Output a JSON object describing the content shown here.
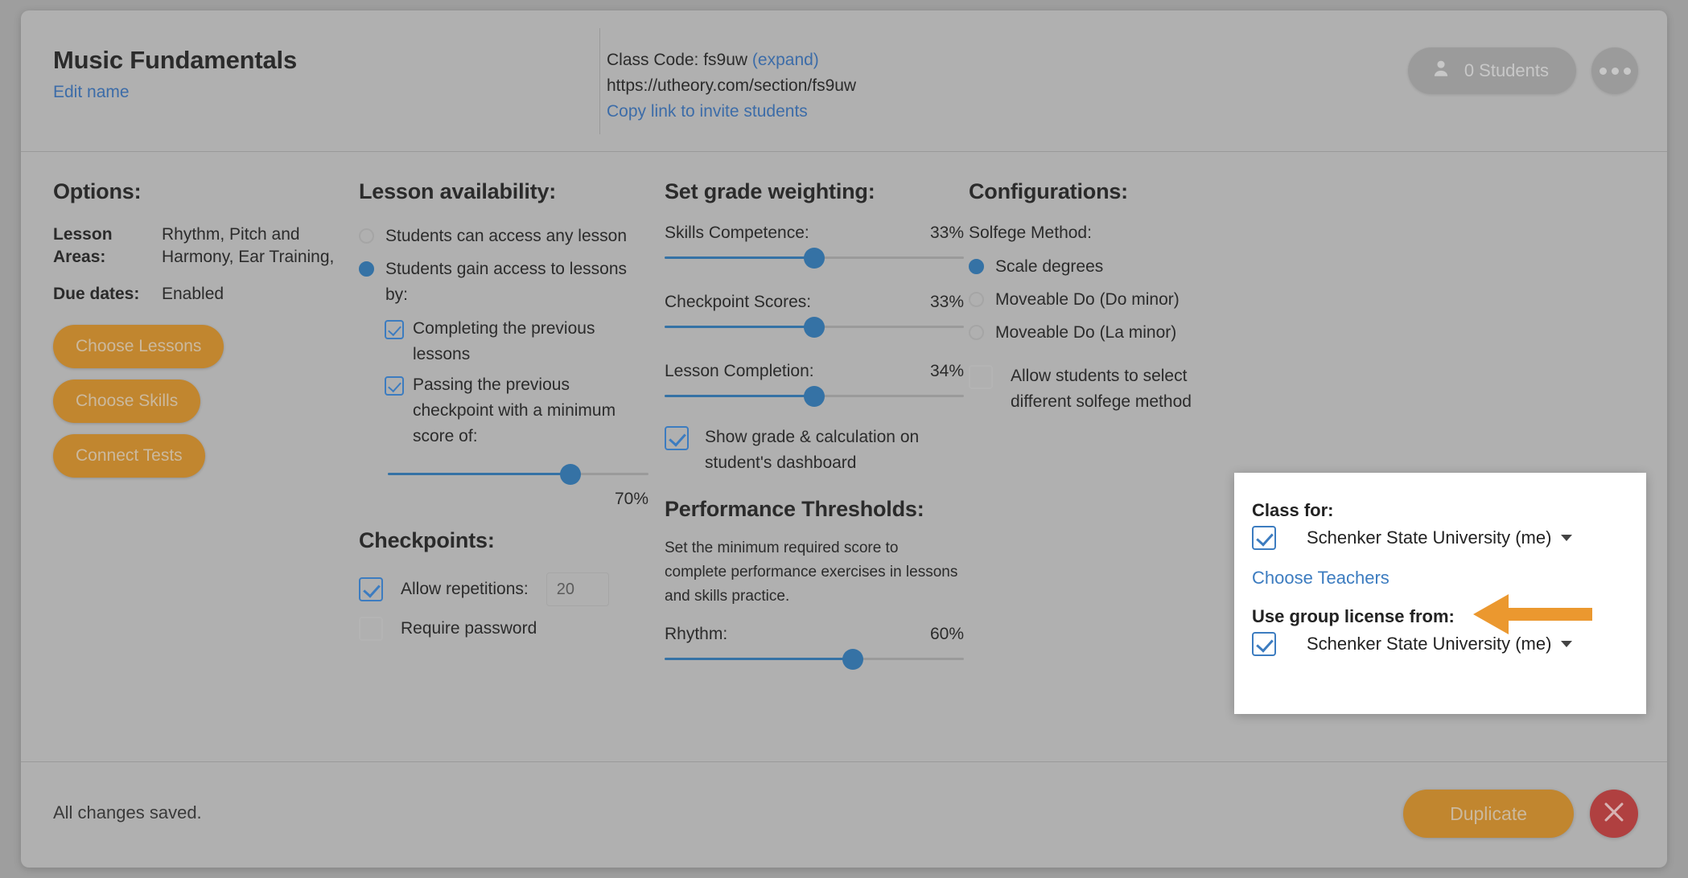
{
  "header": {
    "class_title": "Music Fundamentals",
    "edit_name_link": "Edit name",
    "class_code_label": "Class Code: fs9uw",
    "class_code_expand": "(expand)",
    "class_url": "https://utheory.com/section/fs9uw",
    "copy_link": "Copy link to invite students",
    "students_count_label": "0 Students",
    "more_menu_label": "…"
  },
  "options": {
    "heading": "Options:",
    "rows": [
      {
        "key": "Lesson Areas:",
        "value": "Rhythm, Pitch and Harmony, Ear Training,"
      },
      {
        "key": "Due dates:",
        "value": "Enabled"
      }
    ],
    "buttons": [
      "Choose Lessons",
      "Choose Skills",
      "Connect Tests"
    ]
  },
  "lesson_availability": {
    "heading": "Lesson availability:",
    "radios": [
      {
        "label": "Students can access any lesson",
        "selected": false
      },
      {
        "label": "Students gain access to lessons by:",
        "selected": true
      }
    ],
    "checkboxes": [
      {
        "label": "Completing the previous lessons",
        "checked": true
      },
      {
        "label": "Passing the previous checkpoint with a minimum score of:",
        "checked": true
      }
    ],
    "min_score_slider": {
      "value": 70,
      "display": "70%"
    }
  },
  "checkpoints": {
    "heading": "Checkpoints:",
    "allow_repetitions_label": "Allow repetitions:",
    "allow_repetitions_checked": true,
    "repetitions_value": "20",
    "require_password_label": "Require password",
    "require_password_checked": false
  },
  "grade_weighting": {
    "heading": "Set grade weighting:",
    "sliders": [
      {
        "label": "Skills Competence:",
        "value": 33,
        "display": "33%"
      },
      {
        "label": "Checkpoint Scores:",
        "value": 33,
        "display": "33%"
      },
      {
        "label": "Lesson Completion:",
        "value": 34,
        "display": "34%"
      }
    ],
    "show_grade_label": "Show grade & calculation on student's dashboard",
    "show_grade_checked": true
  },
  "performance_thresholds": {
    "heading": "Performance Thresholds:",
    "description": "Set the minimum required score to complete performance exercises in lessons and skills practice.",
    "sliders": [
      {
        "label": "Rhythm:",
        "value": 60,
        "display": "60%"
      }
    ]
  },
  "configurations": {
    "heading": "Configurations:",
    "solfege_label": "Solfege Method:",
    "radios": [
      {
        "label": "Scale degrees",
        "selected": true
      },
      {
        "label": "Moveable Do (Do minor)",
        "selected": false
      },
      {
        "label": "Moveable Do (La minor)",
        "selected": false
      }
    ],
    "allow_select_label": "Allow students to select different solfege method",
    "allow_select_checked": false
  },
  "popup": {
    "class_for_title": "Class for:",
    "class_for_value": "Schenker State University (me)",
    "class_for_checked": true,
    "choose_teachers_link": "Choose Teachers",
    "group_license_title": "Use group license from:",
    "group_license_value": "Schenker State University (me)",
    "group_license_checked": true
  },
  "footer": {
    "status": "All changes saved.",
    "duplicate_label": "Duplicate",
    "close_label": "×"
  },
  "colors": {
    "accent_orange": "#c1862f",
    "callout_orange": "#eb982f",
    "link_blue": "#3c6ca8",
    "slider_blue": "#3572a5",
    "checkbox_blue": "#3c7cc0",
    "close_red": "#b04040",
    "panel_gray": "#b0b0b0",
    "backdrop_gray": "#9e9e9e",
    "popup_white": "#ffffff"
  }
}
